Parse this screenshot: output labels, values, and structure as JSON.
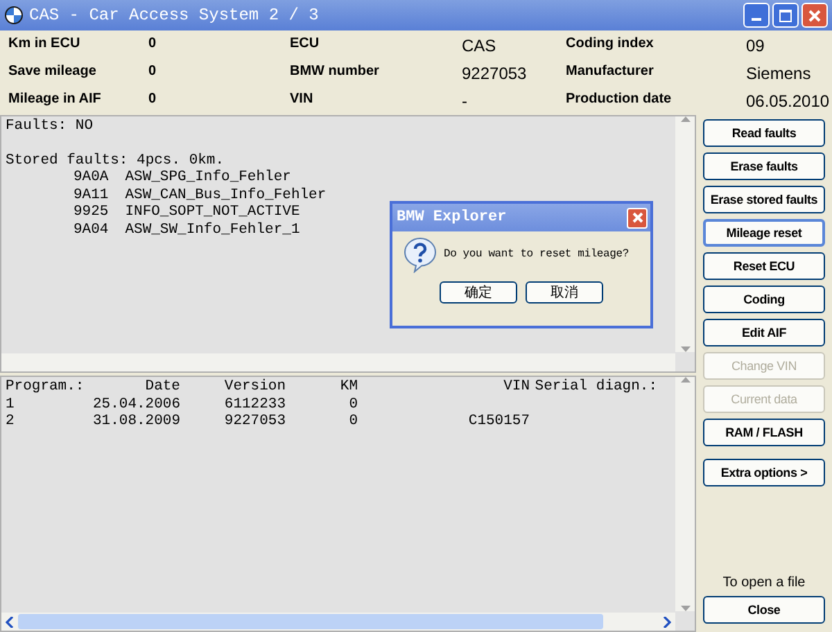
{
  "window": {
    "title": "CAS - Car Access System 2 / 3"
  },
  "info": [
    {
      "label": "Km in ECU",
      "value": "0"
    },
    {
      "label": "ECU",
      "value": "CAS"
    },
    {
      "label": "Coding index",
      "value": "09"
    },
    {
      "label": "Save mileage",
      "value": "0"
    },
    {
      "label": "BMW number",
      "value": "9227053"
    },
    {
      "label": "Manufacturer",
      "value": "Siemens"
    },
    {
      "label": "Mileage in AIF",
      "value": "0"
    },
    {
      "label": "VIN",
      "value": "-"
    },
    {
      "label": "Production date",
      "value": "06.05.2010"
    }
  ],
  "faults": {
    "status": "Faults: NO",
    "stored": "Stored faults: 4pcs. 0km.",
    "items": [
      {
        "code": "9A0A",
        "name": "ASW_SPG_Info_Fehler"
      },
      {
        "code": "9A11",
        "name": "ASW_CAN_Bus_Info_Fehler"
      },
      {
        "code": "9925",
        "name": "INFO_SOPT_NOT_ACTIVE"
      },
      {
        "code": "9A04",
        "name": "ASW_SW_Info_Fehler_1"
      }
    ]
  },
  "programs": {
    "columns": [
      "Program.:",
      "Date",
      "Version",
      "KM",
      "VIN",
      "Serial diagn.:"
    ],
    "rows": [
      [
        "1",
        "25.04.2006",
        "6112233",
        "0"
      ],
      [
        "2",
        "31.08.2009",
        "9227053",
        "0",
        "C150157"
      ]
    ]
  },
  "buttons": [
    {
      "label": "Read faults",
      "disabled": false,
      "focused": false
    },
    {
      "label": "Erase faults",
      "disabled": false,
      "focused": false
    },
    {
      "label": "Erase stored faults",
      "disabled": false,
      "focused": false
    },
    {
      "label": "Mileage reset",
      "disabled": false,
      "focused": true
    },
    {
      "label": "Reset ECU",
      "disabled": false,
      "focused": false
    },
    {
      "label": "Coding",
      "disabled": false,
      "focused": false
    },
    {
      "label": "Edit AIF",
      "disabled": false,
      "focused": false
    },
    {
      "label": "Change VIN",
      "disabled": true,
      "focused": false
    },
    {
      "label": "Current data",
      "disabled": true,
      "focused": false
    },
    {
      "label": "RAM / FLASH",
      "disabled": false,
      "focused": false
    },
    {
      "label": "Extra options >",
      "disabled": false,
      "focused": false
    }
  ],
  "open_hint": "To open a file",
  "close_button": "Close",
  "dialog": {
    "title": "BMW Explorer",
    "message": "Do you want to reset mileage?",
    "buttons": [
      "确定",
      "取消"
    ]
  }
}
